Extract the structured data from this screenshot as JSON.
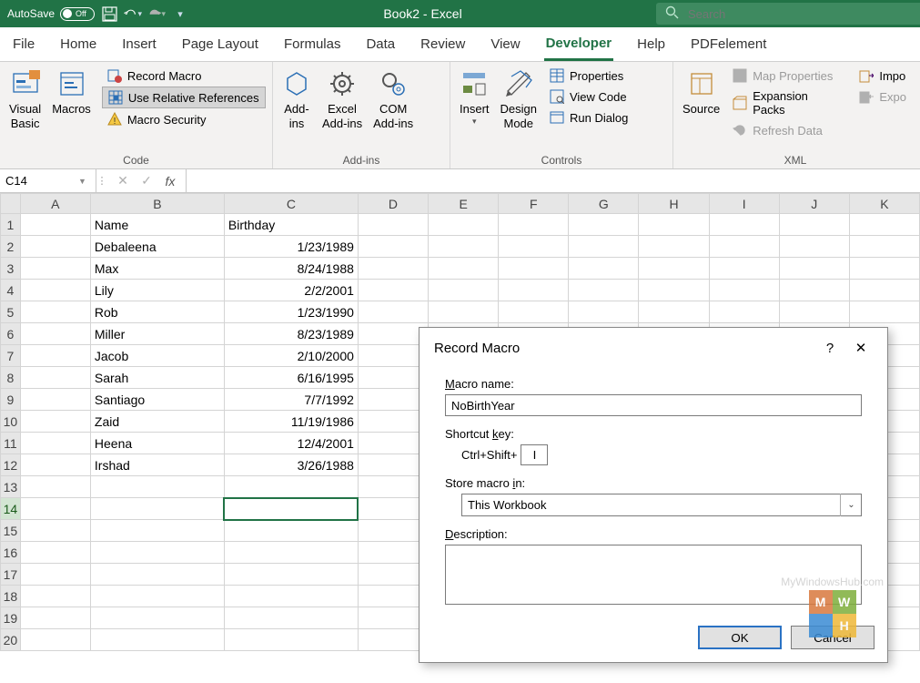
{
  "titlebar": {
    "autosave": "AutoSave",
    "autosave_state": "Off",
    "doc_title": "Book2  -  Excel",
    "search_placeholder": "Search"
  },
  "tabs": {
    "items": [
      "File",
      "Home",
      "Insert",
      "Page Layout",
      "Formulas",
      "Data",
      "Review",
      "View",
      "Developer",
      "Help",
      "PDFelement"
    ],
    "active": "Developer"
  },
  "ribbon": {
    "code": {
      "visual_basic": "Visual\nBasic",
      "macros": "Macros",
      "record": "Record Macro",
      "relative": "Use Relative References",
      "security": "Macro Security",
      "label": "Code"
    },
    "addins": {
      "addins": "Add-\nins",
      "excel_addins": "Excel\nAdd-ins",
      "com_addins": "COM\nAdd-ins",
      "label": "Add-ins"
    },
    "controls": {
      "insert": "Insert",
      "design": "Design\nMode",
      "props": "Properties",
      "view_code": "View Code",
      "run_dialog": "Run Dialog",
      "label": "Controls"
    },
    "xml": {
      "source": "Source",
      "map": "Map Properties",
      "expansion": "Expansion Packs",
      "refresh": "Refresh Data",
      "import": "Impo",
      "export": "Expo",
      "label": "XML"
    }
  },
  "formulabar": {
    "namebox": "C14",
    "fx": "fx",
    "formula": ""
  },
  "grid": {
    "cols": [
      "A",
      "B",
      "C",
      "D",
      "E",
      "F",
      "G",
      "H",
      "I",
      "J",
      "K"
    ],
    "rowcount": 20,
    "active_cell": "C14",
    "data": {
      "B1": "Name",
      "C1": "Birthday",
      "B2": "Debaleena",
      "C2": "1/23/1989",
      "B3": "Max",
      "C3": "8/24/1988",
      "B4": "Lily",
      "C4": "2/2/2001",
      "B5": "Rob",
      "C5": "1/23/1990",
      "B6": "Miller",
      "C6": "8/23/1989",
      "B7": "Jacob",
      "C7": "2/10/2000",
      "B8": "Sarah",
      "C8": "6/16/1995",
      "B9": "Santiago",
      "C9": "7/7/1992",
      "B10": "Zaid",
      "C10": "11/19/1986",
      "B11": "Heena",
      "C11": "12/4/2001",
      "B12": "Irshad",
      "C12": "3/26/1988"
    }
  },
  "dialog": {
    "title": "Record Macro",
    "help": "?",
    "close": "✕",
    "macro_name_label": "Macro name:",
    "macro_name": "NoBirthYear",
    "shortcut_label": "Shortcut key:",
    "shortcut_prefix": "Ctrl+Shift+",
    "shortcut_key": "I",
    "store_label": "Store macro in:",
    "store_value": "This Workbook",
    "description_label": "Description:",
    "description": "",
    "ok": "OK",
    "cancel": "Cancel"
  },
  "watermark": {
    "text": "MyWindowsHub.com",
    "letters": [
      "M",
      "W",
      "",
      "H"
    ]
  }
}
